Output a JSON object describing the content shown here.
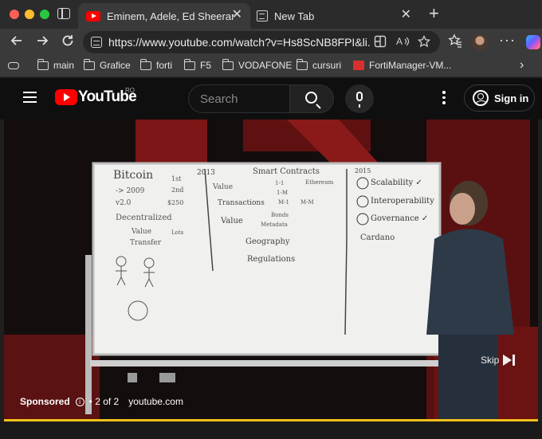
{
  "browser": {
    "tabs": [
      {
        "title": "Eminem, Adele, Ed Sheeran, The Weeknd",
        "active": true
      },
      {
        "title": "New Tab",
        "active": false
      }
    ],
    "new_tab_symbol": "+",
    "close_symbol": "✕",
    "url": "https://www.youtube.com/watch?v=Hs8ScNB8FPI&li...",
    "icons": [
      "back-icon",
      "forward-icon",
      "refresh-icon",
      "lock-icon",
      "split-screen-icon",
      "read-aloud-icon",
      "favorite-star-icon",
      "favorites-icon",
      "profile-avatar",
      "more-icon",
      "copilot-icon"
    ]
  },
  "bookmarks": [
    {
      "label": "main",
      "type": "folder"
    },
    {
      "label": "Grafice",
      "type": "folder"
    },
    {
      "label": "forti",
      "type": "folder"
    },
    {
      "label": "F5",
      "type": "folder"
    },
    {
      "label": "VODAFONE",
      "type": "folder"
    },
    {
      "label": "cursuri",
      "type": "folder"
    },
    {
      "label": "FortiManager-VM...",
      "type": "site"
    }
  ],
  "youtube": {
    "logo": "YouTube",
    "region": "RO",
    "search_placeholder": "Search",
    "signin_label": "Sign in",
    "colors": {
      "brand_red": "#ff0000",
      "ad_progress": "#f2c11a"
    }
  },
  "video": {
    "whiteboard": {
      "col1": [
        "Bitcoin",
        "1st",
        "-> 2009",
        "2nd",
        "v2.0",
        "$250",
        "Decentralized",
        "Value",
        "Transfer",
        "Lots"
      ],
      "col2": [
        "2013",
        "Smart Contracts",
        "Ethereum",
        "Value",
        "Transactions",
        "1-1",
        "1-M",
        "M-1",
        "M-M",
        "Value",
        "Bonds",
        "Metadata",
        "Geography",
        "Regulations"
      ],
      "col3": [
        "2015",
        "Scalability ✓",
        "Interoperability",
        "Governance ✓",
        "Cardano"
      ]
    },
    "ad": {
      "sponsored": "Sponsored",
      "info_symbol": "i",
      "count": "• 2 of 2",
      "domain": "youtube.com",
      "skip_label": "Skip"
    }
  }
}
